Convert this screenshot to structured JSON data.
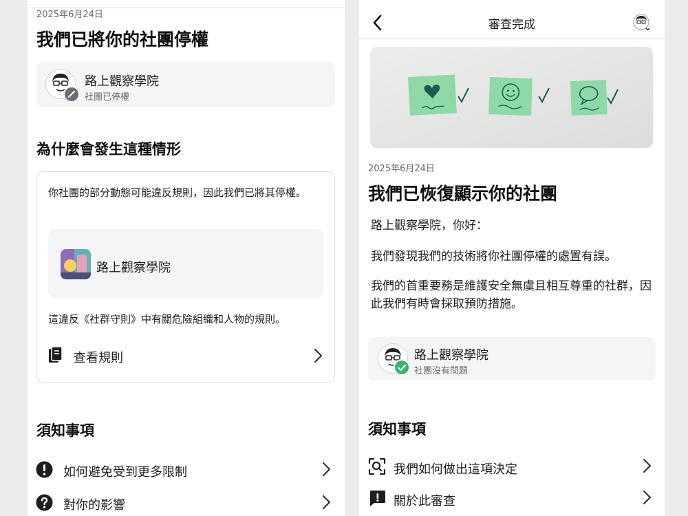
{
  "left": {
    "date": "2025年6月24日",
    "title": "我們已將你的社團停權",
    "group_card": {
      "name": "路上觀察學院",
      "status": "社團已停權"
    },
    "why_heading": "為什麼會發生這種情形",
    "reason_text": "你社團的部分動態可能違反規則，因此我們已將其停權。",
    "post_preview_name": "路上觀察學院",
    "violation_text": "這違反《社群守則》中有關危險組織和人物的規則。",
    "view_rules_label": "查看規則",
    "notice_heading": "須知事項",
    "items": [
      {
        "label": "如何避免受到更多限制",
        "icon": "exclamation-circle-icon"
      },
      {
        "label": "對你的影響",
        "icon": "question-circle-icon"
      }
    ]
  },
  "right": {
    "nav_title": "審查完成",
    "banner_icons": [
      "heart-note-icon",
      "smile-note-icon",
      "speech-bubble-note-icon",
      "checkmark-icon"
    ],
    "date": "2025年6月24日",
    "title": "我們已恢復顯示你的社團",
    "greeting": "路上觀察學院，你好：",
    "para1": "我們發現我們的技術將你社團停權的處置有誤。",
    "para2": "我們的首重要務是維護安全無虞且相互尊重的社群，因此我們有時會採取預防措施。",
    "group_card": {
      "name": "路上觀察學院",
      "status": "社團沒有問題"
    },
    "notice_heading": "須知事項",
    "items": [
      {
        "label": "我們如何做出這項決定",
        "icon": "scan-search-icon"
      },
      {
        "label": "關於此審查",
        "icon": "alert-speech-bubble-icon"
      }
    ]
  },
  "colors": {
    "accent_green": "#3cb371",
    "note_green": "#8fd9a8",
    "ink": "#1f5a4f"
  }
}
